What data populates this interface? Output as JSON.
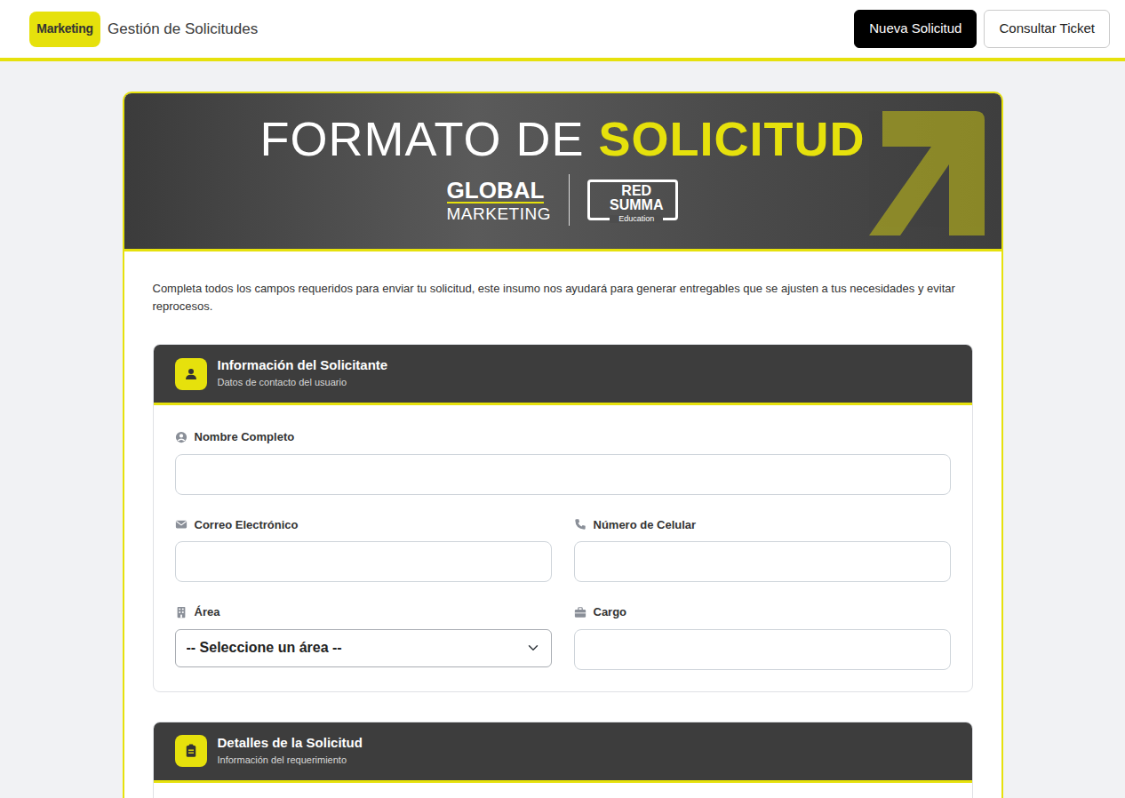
{
  "navbar": {
    "logo": "Marketing",
    "title": "Gestión de Solicitudes",
    "buttons": [
      {
        "label": "Nueva Solicitud",
        "selected": true
      },
      {
        "label": "Consultar Ticket",
        "selected": false
      }
    ]
  },
  "banner": {
    "title": [
      "FORMATO DE",
      "SOLICITUD"
    ],
    "brand_left": [
      "GLOBAL",
      "MARKETING"
    ],
    "brand_right": [
      "RED",
      "SUMMA",
      "Education"
    ]
  },
  "intro": "Completa todos los campos requeridos para enviar tu solicitud, este insumo nos ayudará para generar entregables que se ajusten a tus necesidades y evitar reprocesos.",
  "sections": [
    {
      "title": "Información del Solicitante",
      "subtitle": "Datos de contacto del usuario",
      "fields": [
        {
          "label": "Nombre Completo",
          "kind": "text"
        },
        {
          "label": "Correo Electrónico",
          "kind": "email"
        },
        {
          "label": "Número de Celular",
          "kind": "number"
        },
        {
          "label": "Área",
          "kind": "select",
          "value": "-- Seleccione un área --"
        },
        {
          "label": "Cargo",
          "kind": "text"
        }
      ]
    },
    {
      "title": "Detalles de la Solicitud",
      "subtitle": "Información del requerimiento",
      "fields": []
    }
  ]
}
